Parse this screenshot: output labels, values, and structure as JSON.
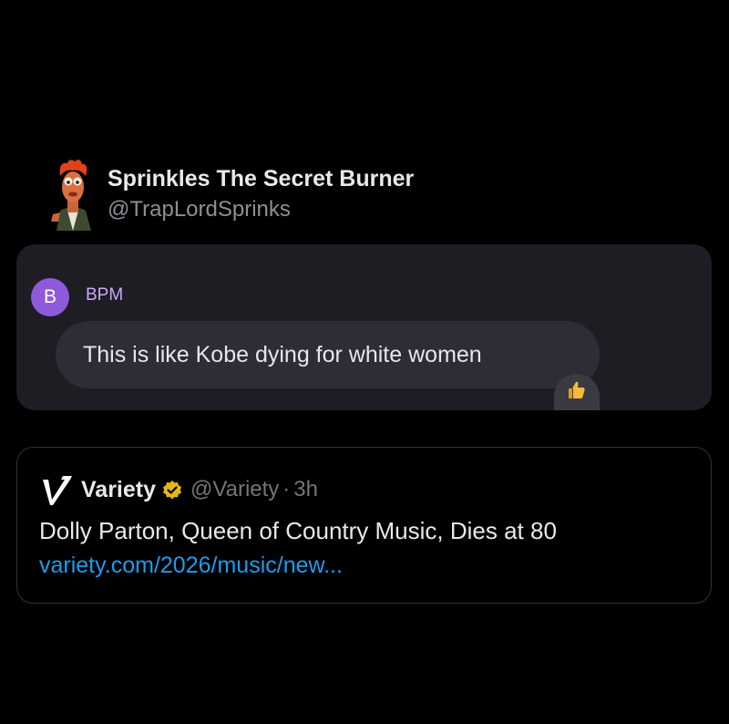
{
  "author": {
    "name": "Sprinkles The Secret Burner",
    "handle": "@TrapLordSprinks",
    "avatar_icon": "beaker-muppet-avatar"
  },
  "chat": {
    "sender_initial": "B",
    "sender_name": "BPM",
    "message": "This is like Kobe dying for white women",
    "reaction": "👍",
    "colors": {
      "card_bg": "#1d1d23",
      "bubble_bg": "#2d2d35",
      "avatar_bg": "#8f59dc",
      "sender_name": "#c9a8f7"
    }
  },
  "quote": {
    "logo_icon": "variety-v-logo-icon",
    "name": "Variety",
    "verified_icon": "gold-verified-badge-icon",
    "handle": "@Variety",
    "separator": "·",
    "time": "3h",
    "headline": "Dolly Parton, Queen of Country Music, Dies at 80",
    "link": "variety.com/2026/music/new...",
    "colors": {
      "link": "#1d9bf0",
      "verified": "#e2b719",
      "muted": "#71767b"
    }
  }
}
